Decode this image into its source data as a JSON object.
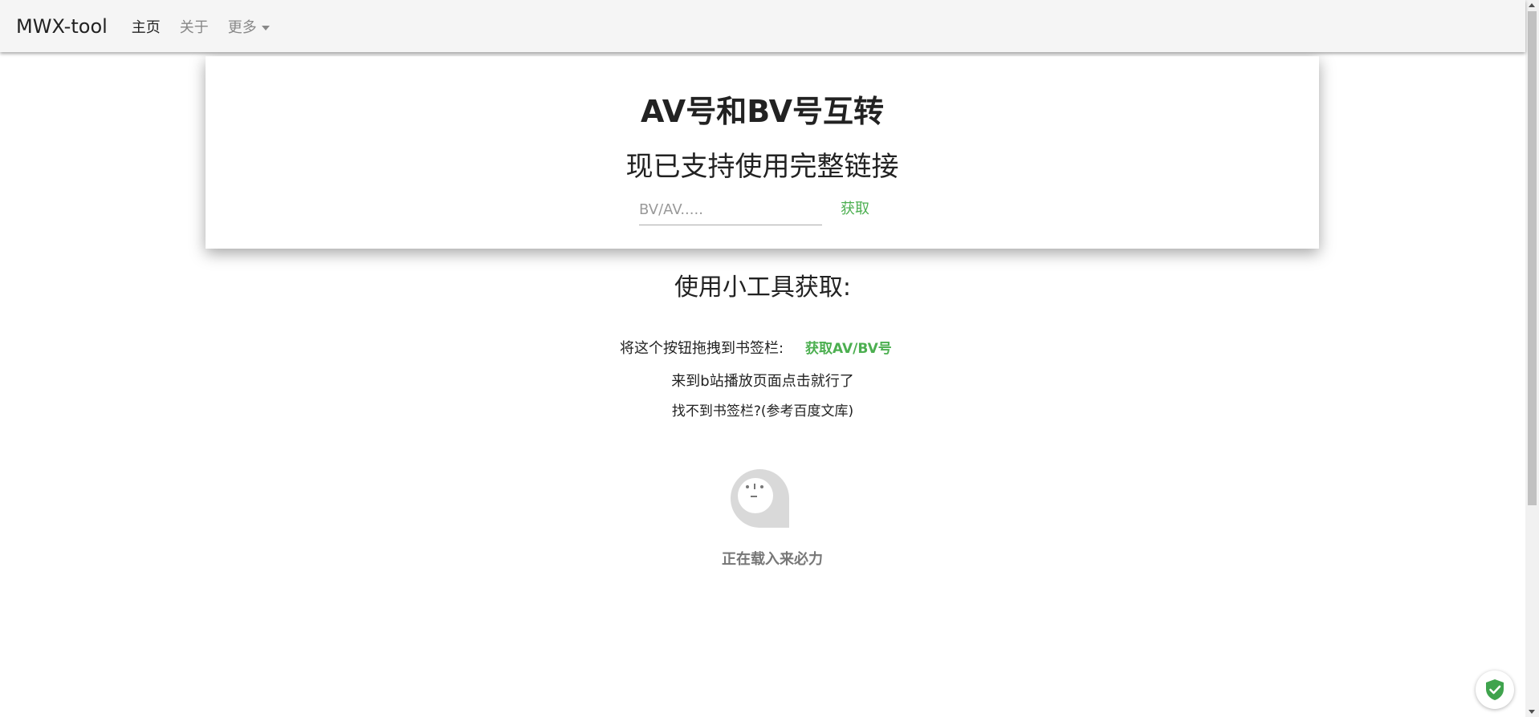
{
  "navbar": {
    "brand": "MWX-tool",
    "items": [
      {
        "label": "主页"
      },
      {
        "label": "关于"
      },
      {
        "label": "更多"
      }
    ]
  },
  "card": {
    "title": "AV号和BV号互转",
    "subtitle": "现已支持使用完整链接",
    "input_placeholder": "BV/AV.....",
    "fetch_label": "获取"
  },
  "tools": {
    "title": "使用小工具获取:",
    "bookmark_instruction": "将这个按钮拖拽到书签栏:",
    "bookmark_link": "获取AV/BV号",
    "usage_hint": "来到b站播放页面点击就行了",
    "help_link": "找不到书签栏?(参考百度文库)"
  },
  "loading": {
    "text": "正在载入来必力"
  },
  "colors": {
    "accent": "#4caf50",
    "navbar_bg": "#f5f5f5"
  }
}
